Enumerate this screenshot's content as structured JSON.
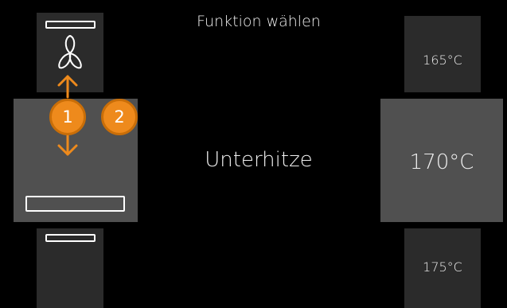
{
  "header": {
    "title": "Funktion wählen"
  },
  "functions": {
    "above": {
      "icon": "fan-icon"
    },
    "selected": {
      "label": "Unterhitze",
      "icon": "bottom-heat-icon"
    },
    "below": {
      "icon": "bottom-heat-icon"
    }
  },
  "temperatures": {
    "above": "165°C",
    "selected": "170°C",
    "below": "175°C"
  },
  "badges": {
    "one": "1",
    "two": "2"
  },
  "colors": {
    "accent": "#ee8a1c",
    "tile": "#2b2b2b",
    "tile_selected": "#505050"
  }
}
